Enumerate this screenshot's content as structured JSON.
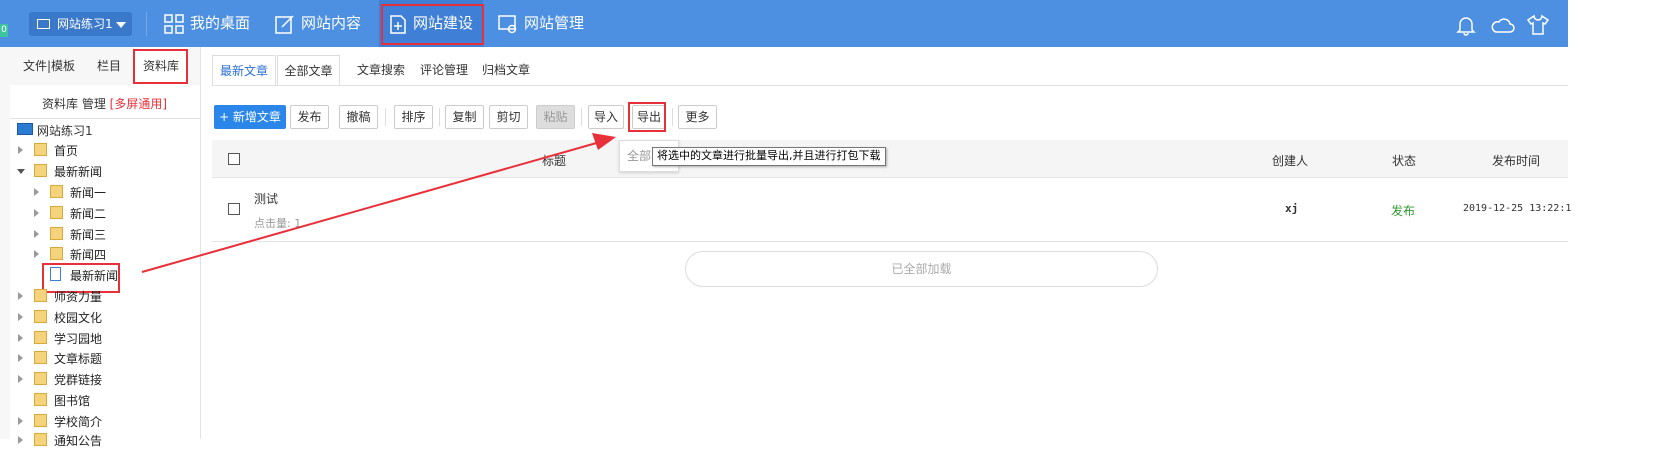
{
  "topbar": {
    "site_selector": "网站练习1",
    "badge": "0",
    "nav": [
      "我的桌面",
      "网站内容",
      "网站建设",
      "网站管理"
    ]
  },
  "sidebar": {
    "tabs": [
      "文件|模板",
      "栏目",
      "资料库"
    ],
    "library_title": "资料库 管理",
    "library_tag": "[多屏通用]",
    "root": "网站练习1",
    "items": [
      {
        "label": "首页"
      },
      {
        "label": "最新新闻"
      },
      {
        "label": "新闻一"
      },
      {
        "label": "新闻二"
      },
      {
        "label": "新闻三"
      },
      {
        "label": "新闻四"
      },
      {
        "label": "最新新闻"
      },
      {
        "label": "师资力量"
      },
      {
        "label": "校园文化"
      },
      {
        "label": "学习园地"
      },
      {
        "label": "文章标题"
      },
      {
        "label": "党群链接"
      },
      {
        "label": "图书馆"
      },
      {
        "label": "学校简介"
      },
      {
        "label": "通知公告"
      }
    ]
  },
  "content": {
    "tabs": [
      "最新文章",
      "全部文章",
      "文章搜索",
      "评论管理",
      "归档文章"
    ],
    "toolbar": {
      "add": "+ 新增文章",
      "publish": "发布",
      "withdraw": "撤稿",
      "sort": "排序",
      "copy": "复制",
      "cut": "剪切",
      "paste": "粘贴",
      "import": "导入",
      "export": "导出",
      "more": "更多"
    },
    "columns": {
      "title": "标题",
      "creator": "创建人",
      "status": "状态",
      "publish_time": "发布时间"
    },
    "rows": [
      {
        "title": "测试",
        "clicks": "点击量: 1",
        "creator": "xj",
        "status": "发布",
        "time": "2019-12-25 13:22:1"
      }
    ],
    "loaded_text": "已全部加载",
    "popup_fragment": "全部",
    "tooltip": "将选中的文章进行批量导出,并且进行打包下载"
  },
  "colors": {
    "topbar": "#4d8fe0",
    "primary": "#2a86e8",
    "highlight": "#e8303a",
    "published": "#2e9a2e"
  },
  "icons": [
    "monitor-icon",
    "grid-icon",
    "edit-icon",
    "add-page-icon",
    "site-manage-icon",
    "bell-icon",
    "cloud-icon",
    "shirt-icon"
  ]
}
